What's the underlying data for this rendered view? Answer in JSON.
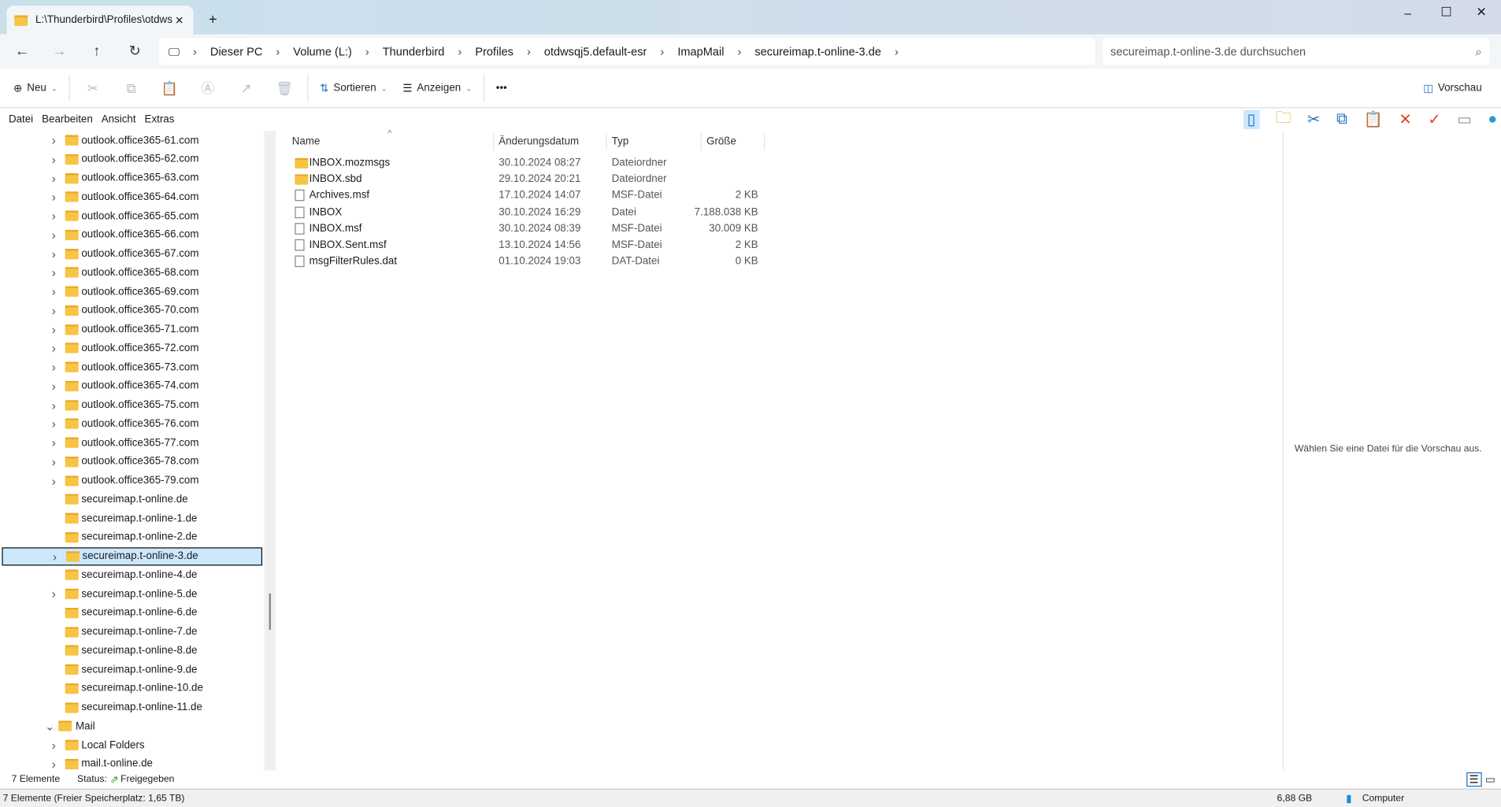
{
  "window": {
    "tab_title": "L:\\Thunderbird\\Profiles\\otdws",
    "new_tab": "+",
    "minimize": "–",
    "maximize": "☐",
    "close": "✕"
  },
  "breadcrumb": [
    "Dieser PC",
    "Volume (L:)",
    "Thunderbird",
    "Profiles",
    "otdwsqj5.default-esr",
    "ImapMail",
    "secureimap.t-online-3.de"
  ],
  "search": {
    "placeholder": "secureimap.t-online-3.de durchsuchen"
  },
  "toolbar": {
    "new": "Neu",
    "sort": "Sortieren",
    "view": "Anzeigen",
    "more": "•••",
    "preview": "Vorschau"
  },
  "menu": [
    "Datei",
    "Bearbeiten",
    "Ansicht",
    "Extras"
  ],
  "tree": [
    {
      "label": "outlook.office365-61.com",
      "chev": true
    },
    {
      "label": "outlook.office365-62.com",
      "chev": true
    },
    {
      "label": "outlook.office365-63.com",
      "chev": true
    },
    {
      "label": "outlook.office365-64.com",
      "chev": true
    },
    {
      "label": "outlook.office365-65.com",
      "chev": true
    },
    {
      "label": "outlook.office365-66.com",
      "chev": true
    },
    {
      "label": "outlook.office365-67.com",
      "chev": true
    },
    {
      "label": "outlook.office365-68.com",
      "chev": true
    },
    {
      "label": "outlook.office365-69.com",
      "chev": true
    },
    {
      "label": "outlook.office365-70.com",
      "chev": true
    },
    {
      "label": "outlook.office365-71.com",
      "chev": true
    },
    {
      "label": "outlook.office365-72.com",
      "chev": true
    },
    {
      "label": "outlook.office365-73.com",
      "chev": true
    },
    {
      "label": "outlook.office365-74.com",
      "chev": true
    },
    {
      "label": "outlook.office365-75.com",
      "chev": true
    },
    {
      "label": "outlook.office365-76.com",
      "chev": true
    },
    {
      "label": "outlook.office365-77.com",
      "chev": true
    },
    {
      "label": "outlook.office365-78.com",
      "chev": true
    },
    {
      "label": "outlook.office365-79.com",
      "chev": true
    },
    {
      "label": "secureimap.t-online.de",
      "chev": false
    },
    {
      "label": "secureimap.t-online-1.de",
      "chev": false
    },
    {
      "label": "secureimap.t-online-2.de",
      "chev": false
    },
    {
      "label": "secureimap.t-online-3.de",
      "chev": true,
      "selected": true
    },
    {
      "label": "secureimap.t-online-4.de",
      "chev": false
    },
    {
      "label": "secureimap.t-online-5.de",
      "chev": true
    },
    {
      "label": "secureimap.t-online-6.de",
      "chev": false
    },
    {
      "label": "secureimap.t-online-7.de",
      "chev": false
    },
    {
      "label": "secureimap.t-online-8.de",
      "chev": false
    },
    {
      "label": "secureimap.t-online-9.de",
      "chev": false
    },
    {
      "label": "secureimap.t-online-10.de",
      "chev": false
    },
    {
      "label": "secureimap.t-online-11.de",
      "chev": false
    },
    {
      "label": "Mail",
      "chev": "open",
      "level": 0
    },
    {
      "label": "Local Folders",
      "chev": true
    },
    {
      "label": "mail.t-online.de",
      "chev": true
    }
  ],
  "columns": {
    "name": "Name",
    "date": "Änderungsdatum",
    "type": "Typ",
    "size": "Größe"
  },
  "files": [
    {
      "name": "INBOX.mozmsgs",
      "date": "30.10.2024 08:27",
      "type": "Dateiordner",
      "size": "",
      "folder": true
    },
    {
      "name": "INBOX.sbd",
      "date": "29.10.2024 20:21",
      "type": "Dateiordner",
      "size": "",
      "folder": true
    },
    {
      "name": "Archives.msf",
      "date": "17.10.2024 14:07",
      "type": "MSF-Datei",
      "size": "2 KB"
    },
    {
      "name": "INBOX",
      "date": "30.10.2024 16:29",
      "type": "Datei",
      "size": "7.188.038 KB"
    },
    {
      "name": "INBOX.msf",
      "date": "30.10.2024 08:39",
      "type": "MSF-Datei",
      "size": "30.009 KB"
    },
    {
      "name": "INBOX.Sent.msf",
      "date": "13.10.2024 14:56",
      "type": "MSF-Datei",
      "size": "2 KB"
    },
    {
      "name": "msgFilterRules.dat",
      "date": "01.10.2024 19:03",
      "type": "DAT-Datei",
      "size": "0 KB"
    }
  ],
  "preview_text": "Wählen Sie eine Datei für die Vorschau aus.",
  "status": {
    "count": "7 Elemente",
    "status_label": "Status:",
    "status_value": "Freigegeben",
    "bottom": "7 Elemente (Freier Speicherplatz: 1,65 TB)",
    "size": "6,88 GB",
    "location": "Computer"
  }
}
